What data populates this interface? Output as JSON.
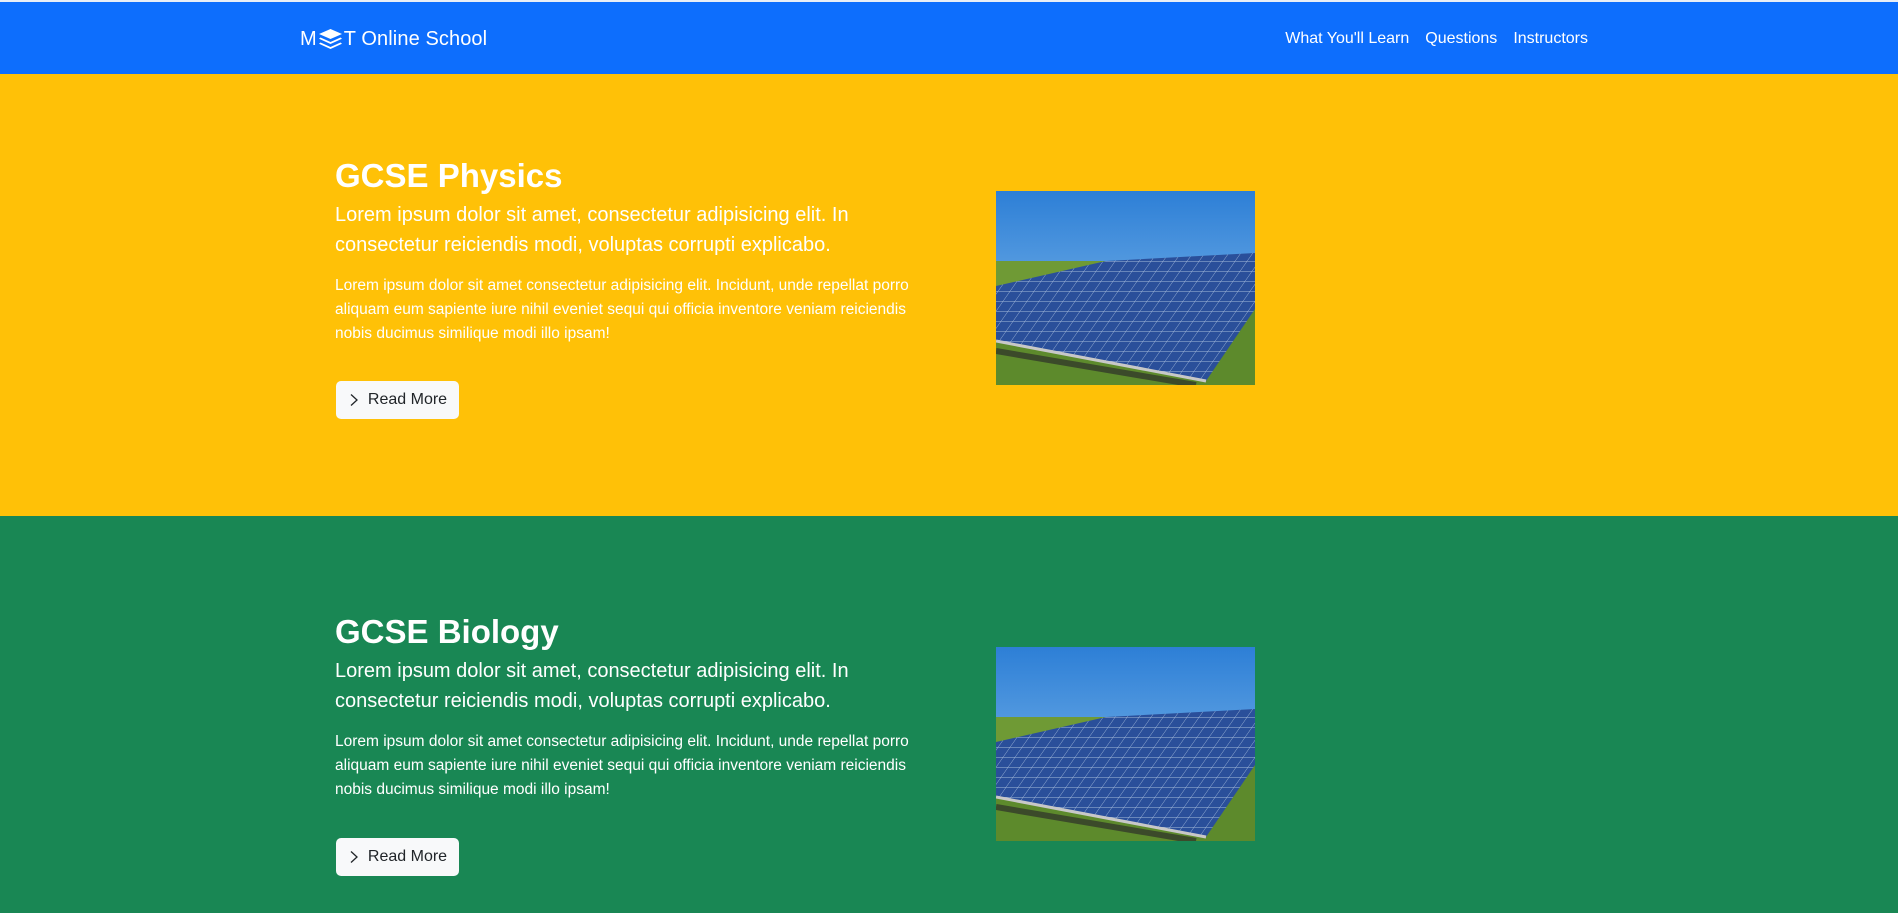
{
  "navbar": {
    "brand_prefix": "M",
    "brand_suffix": "T Online School",
    "links": [
      "What You'll Learn",
      "Questions",
      "Instructors"
    ]
  },
  "sections": [
    {
      "title": "GCSE Physics",
      "lead": "Lorem ipsum dolor sit amet, consectetur adipisicing elit. In consectetur reiciendis modi, voluptas corrupti explicabo.",
      "body": "Lorem ipsum dolor sit amet consectetur adipisicing elit. Incidunt, unde repellat porro aliquam eum sapiente iure nihil eveniet sequi qui officia inventore veniam reiciendis nobis ducimus similique modi illo ipsam!",
      "button": "Read More",
      "image": "solar-panels-image",
      "bg": "#ffc107"
    },
    {
      "title": "GCSE Biology",
      "lead": "Lorem ipsum dolor sit amet, consectetur adipisicing elit. In consectetur reiciendis modi, voluptas corrupti explicabo.",
      "body": "Lorem ipsum dolor sit amet consectetur adipisicing elit. Incidunt, unde repellat porro aliquam eum sapiente iure nihil eveniet sequi qui officia inventore veniam reiciendis nobis ducimus similique modi illo ipsam!",
      "button": "Read More",
      "image": "solar-panels-image",
      "bg": "#198754"
    }
  ],
  "colors": {
    "navbar": "#0d6efd",
    "physics": "#ffc107",
    "biology": "#198754",
    "button": "#f8f9fa"
  }
}
